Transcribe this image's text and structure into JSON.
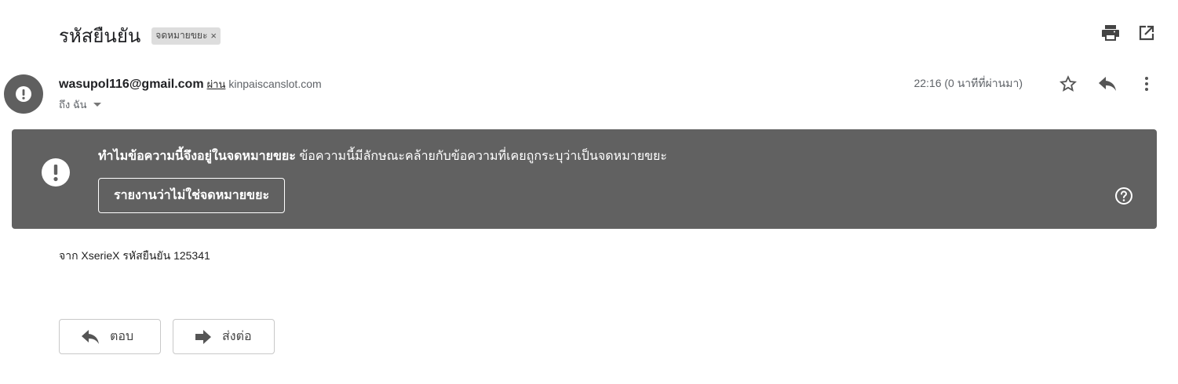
{
  "email": {
    "subject": "รหัสยืนยัน",
    "label": "จดหมายขยะ",
    "label_remove": "×",
    "sender_email": "wasupol116@gmail.com",
    "via_text": "ผ่าน",
    "via_domain": "kinpaiscanslot.com",
    "to_text": "ถึง ฉัน",
    "timestamp": "22:16 (0 นาทีที่ผ่านมา)",
    "body": "จาก XserieX รหัสยืนยัน 125341"
  },
  "spam_banner": {
    "title": "ทำไมข้อความนี้จึงอยู่ในจดหมายขยะ",
    "description": "ข้อความนี้มีลักษณะคล้ายกับข้อความที่เคยถูกระบุว่าเป็นจดหมายขยะ",
    "button_label": "รายงานว่าไม่ใช่จดหมายขยะ",
    "background_color": "#616161"
  },
  "actions": {
    "reply_label": "ตอบ",
    "forward_label": "ส่งต่อ"
  },
  "icons": {
    "print": "print-icon",
    "open_new_window": "open-in-new-icon",
    "star": "star-icon",
    "reply": "reply-icon",
    "more": "more-vert-icon",
    "warning": "warning-icon",
    "help": "help-icon",
    "forward": "forward-icon"
  }
}
